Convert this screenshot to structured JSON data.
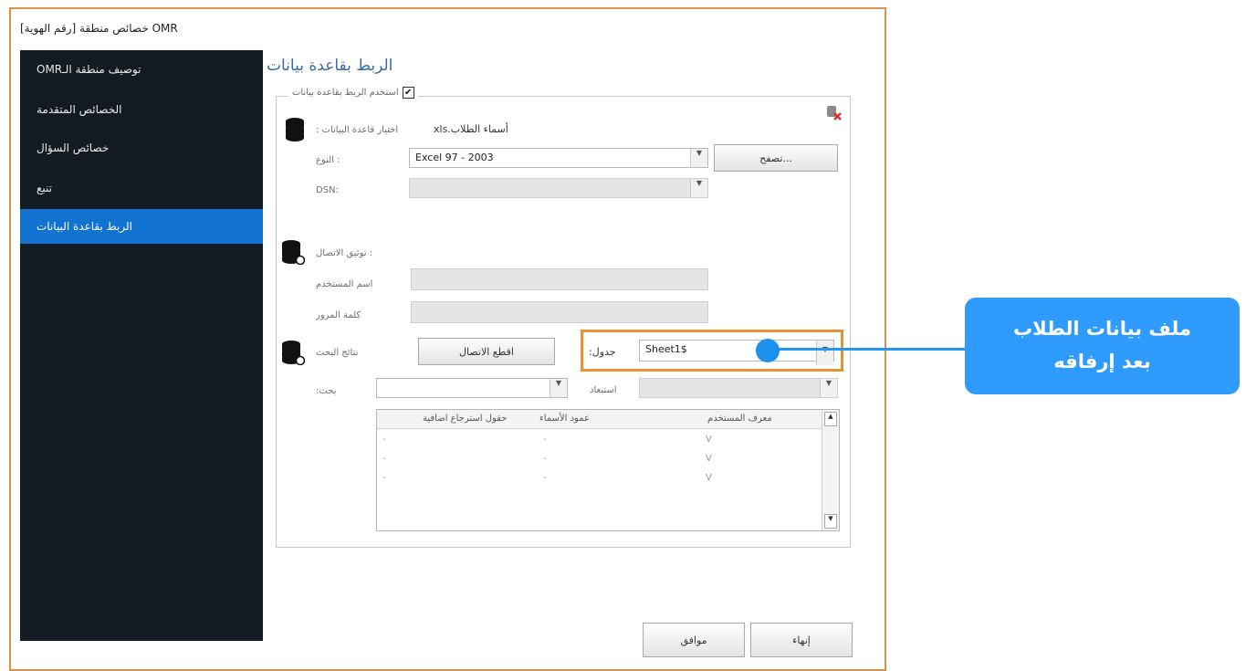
{
  "window": {
    "title": "خصائص منطقة [رقم الهوية] OMR"
  },
  "sidebar": {
    "items": [
      {
        "label": "توصيف منطقة الـOMR"
      },
      {
        "label": "الخصائص المتقدمة"
      },
      {
        "label": "خصائص السؤال"
      },
      {
        "label": "تنبع"
      },
      {
        "label": "الربط بقاعدة البيانات"
      }
    ]
  },
  "content": {
    "title": "الربط بقاعدة بيانات",
    "use_db_checkbox": {
      "label": "استخدم الربط بقاعدة بيانات",
      "mark": "✔"
    },
    "db_choose": {
      "label": "اختيار قاعدة البيانات :",
      "file": "أسماء الطلاب.xls"
    },
    "type": {
      "label": ": النوع",
      "value": "Excel 97 - 2003"
    },
    "browse_label": "تصفح...",
    "dsn": {
      "label": "DSN:",
      "value": ""
    },
    "auth": {
      "label": ": توثيق الاتصال",
      "username_label": "اسم المستخدم",
      "password_label": "كلمة المرور"
    },
    "search_results_label": "نتائج البحث",
    "disconnect_label": "اقطع الاتصال",
    "table": {
      "label": "جدول:",
      "value": "Sheet1$"
    },
    "search": {
      "label": "بحث:",
      "value": ""
    },
    "exclude_label": "استبعاد",
    "grid": {
      "headers": [
        "معرف المستخدم",
        "عمود الأسماء",
        "حقول استرجاع اضافية"
      ],
      "rows": [
        [
          "V",
          "-",
          "-"
        ],
        [
          "V",
          "-",
          "-"
        ],
        [
          "V",
          "-",
          "-"
        ]
      ]
    }
  },
  "footer": {
    "ok_label": "موافق",
    "finish_label": "إنهاء"
  },
  "callout": {
    "line1": "ملف بيانات الطلاب",
    "line2": "بعد إرفاقه"
  },
  "colors": {
    "sidebar_bg": "#141a22",
    "sidebar_active": "#1173cf",
    "highlight_border": "#e89232",
    "callout": "#2f9bff"
  }
}
